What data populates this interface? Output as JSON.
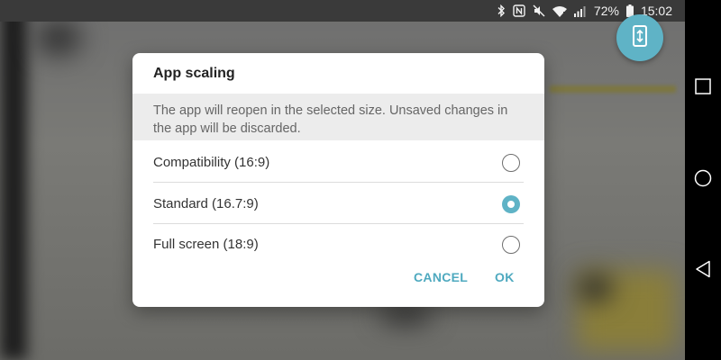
{
  "status_bar": {
    "battery_percent": "72%",
    "time": "15:02",
    "icons": [
      "bluetooth-icon",
      "nfc-icon",
      "mute-icon",
      "wifi-icon",
      "signal-icon",
      "battery-icon"
    ]
  },
  "dialog": {
    "title": "App scaling",
    "message": "The app will reopen in the selected size. Unsaved changes in the app will be discarded.",
    "options": [
      {
        "label": "Compatibility (16:9)",
        "selected": false
      },
      {
        "label": "Standard (16.7:9)",
        "selected": true
      },
      {
        "label": "Full screen (18:9)",
        "selected": false
      }
    ],
    "cancel_label": "CANCEL",
    "ok_label": "OK"
  },
  "colors": {
    "accent": "#5fb3c6",
    "button_text": "#4ea9bf",
    "message_bg": "#ececec"
  },
  "fab": {
    "icon": "app-scaling-icon"
  },
  "nav_bar": {
    "buttons": [
      "recents-icon",
      "home-icon",
      "back-icon"
    ]
  }
}
